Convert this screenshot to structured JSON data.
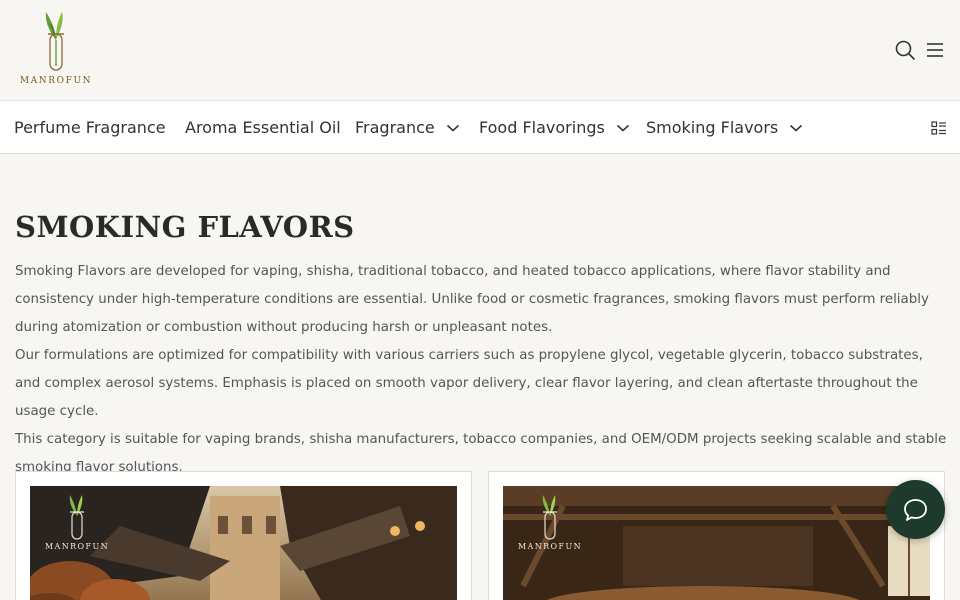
{
  "brand": {
    "name": "MANROFUN"
  },
  "header": {
    "icons": [
      "search-icon",
      "menu-icon"
    ]
  },
  "nav": {
    "items": [
      {
        "label": "Perfume Fragrance",
        "has_dropdown": false
      },
      {
        "label": "Aroma Essential Oil",
        "has_dropdown": false
      },
      {
        "label": "Fragrance",
        "has_dropdown": true
      },
      {
        "label": "Food Flavorings",
        "has_dropdown": true
      },
      {
        "label": "Smoking Flavors",
        "has_dropdown": true
      }
    ]
  },
  "page": {
    "title": "SMOKING FLAVORS",
    "paragraphs": [
      "Smoking Flavors are developed for vaping, shisha, traditional tobacco, and heated tobacco applications, where flavor stability and consistency under high-temperature conditions are essential. Unlike food or cosmetic fragrances, smoking flavors must perform reliably during atomization or combustion without producing harsh or unpleasant notes.",
      "Our formulations are optimized for compatibility with various carriers such as propylene glycol, vegetable glycerin, tobacco substrates, and complex aerosol systems. Emphasis is placed on smooth vapor delivery, clear flavor layering, and clean aftertaste throughout the usage cycle.",
      "This category is suitable for vaping brands, shisha manufacturers, tobacco companies, and OEM/ODM projects seeking scalable and stable smoking flavor solutions."
    ]
  },
  "cards": [
    {
      "logo_text": "MANROFUN"
    },
    {
      "logo_text": "MANROFUN"
    }
  ],
  "colors": {
    "accent_dark_green": "#1e3a2c",
    "logo_gold": "#7a5a22",
    "background": "#f7f6f2"
  }
}
